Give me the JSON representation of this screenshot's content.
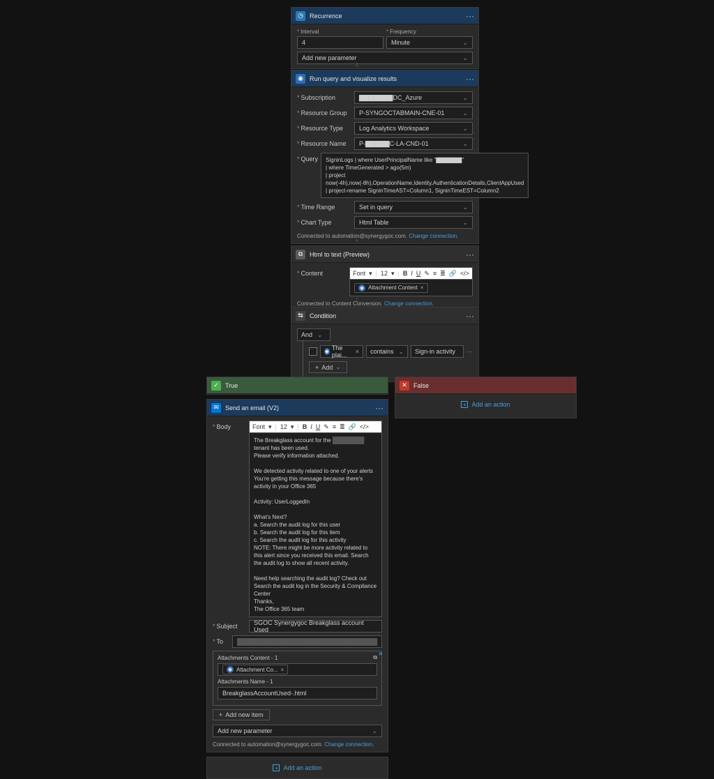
{
  "recurrence": {
    "title": "Recurrence",
    "interval_label": "Interval",
    "interval_value": "4",
    "frequency_label": "Frequency",
    "frequency_value": "Minute",
    "add_param": "Add new parameter"
  },
  "runquery": {
    "title": "Run query and visualize results",
    "subscription_label": "Subscription",
    "subscription_value": "▇▇▇▇▇▇▇DC_Azure",
    "rg_label": "Resource Group",
    "rg_value": "P-SYNGOCTABMAIN-CNE-01",
    "rt_label": "Resource Type",
    "rt_value": "Log Analytics Workspace",
    "rn_label": "Resource Name",
    "rn_value": "P-▇▇▇▇▇C-LA-CND-01",
    "query_label": "Query",
    "query_l1": "SigninLogs | where UserPrincipalName like \"▇▇▇▇▇▇\"",
    "query_l2": "| where TimeGenerated > ago(5m)",
    "query_l3": "| project",
    "query_l4": "now(-4h),now(-8h),OperationName,Identity,AuthenticationDetails,ClientAppUsed",
    "query_l5": "| project-rename SigninTimeAST=Column1, SigninTimeEST=Column2",
    "tr_label": "Time Range",
    "tr_value": "Set in query",
    "ct_label": "Chart Type",
    "ct_value": "Html Table",
    "conn_text": "Connected to automation@synergygoc.com. ",
    "conn_link": "Change connection."
  },
  "htmltext": {
    "title": "Html to text (Preview)",
    "content_label": "Content",
    "pill_label": "Attachment Content",
    "conn_text": "Connected to Content Conversion. ",
    "conn_link": "Change connection."
  },
  "condition": {
    "title": "Condition",
    "and_label": "And",
    "token": "The plai...",
    "operator": "contains",
    "value": "Sign-in activity",
    "add": "Add"
  },
  "branch_true": {
    "title": "True"
  },
  "branch_false": {
    "title": "False",
    "add_action": "Add an action"
  },
  "sendemail": {
    "title": "Send an email (V2)",
    "body_label": "Body",
    "line1a": "The Breakglass account for the ",
    "line1b": " tenant has been used.",
    "line2": "Please verify information attached.",
    "line3": "We detected activity related to one of your alerts",
    "line4": "You're getting this message because there's activity in your Office 365",
    "line5": "Activity: UserLoggedIn",
    "line6": "What's Next?",
    "line7": "a. Search the audit log for this user",
    "line8": "b. Search the audit log for this item",
    "line9": "c. Search the audit log for this activity",
    "line10": "NOTE: There might be more activity related to this alert since you received this email. Search the audit log to show all recent activity.",
    "line11": "Need help searching the audit log? Check out Search the audit log in the Security & Compliance Center",
    "line12": "Thanks,",
    "line13": "The Office 365 team",
    "subject_label": "Subject",
    "subject_value": "SGOC Synergygoc Breakglass account Used",
    "to_label": "To",
    "to_value": "▇▇▇▇▇▇▇▇▇▇▇▇▇▇▇▇▇▇▇▇▇▇▇▇▇▇▇▇▇",
    "attach_content_label": "Attachments Content - 1",
    "attach_pill": "Attachment Co...",
    "attach_name_label": "Attachments Name - 1",
    "attach_name_value": "BreakglassAccountUsed-.html",
    "add_item": "Add new item",
    "add_param": "Add new parameter",
    "conn_text": "Connected to automation@synergygoc.com. ",
    "conn_link": "Change connection.",
    "add_action": "Add an action"
  },
  "rte": {
    "font": "Font",
    "size": "12"
  }
}
